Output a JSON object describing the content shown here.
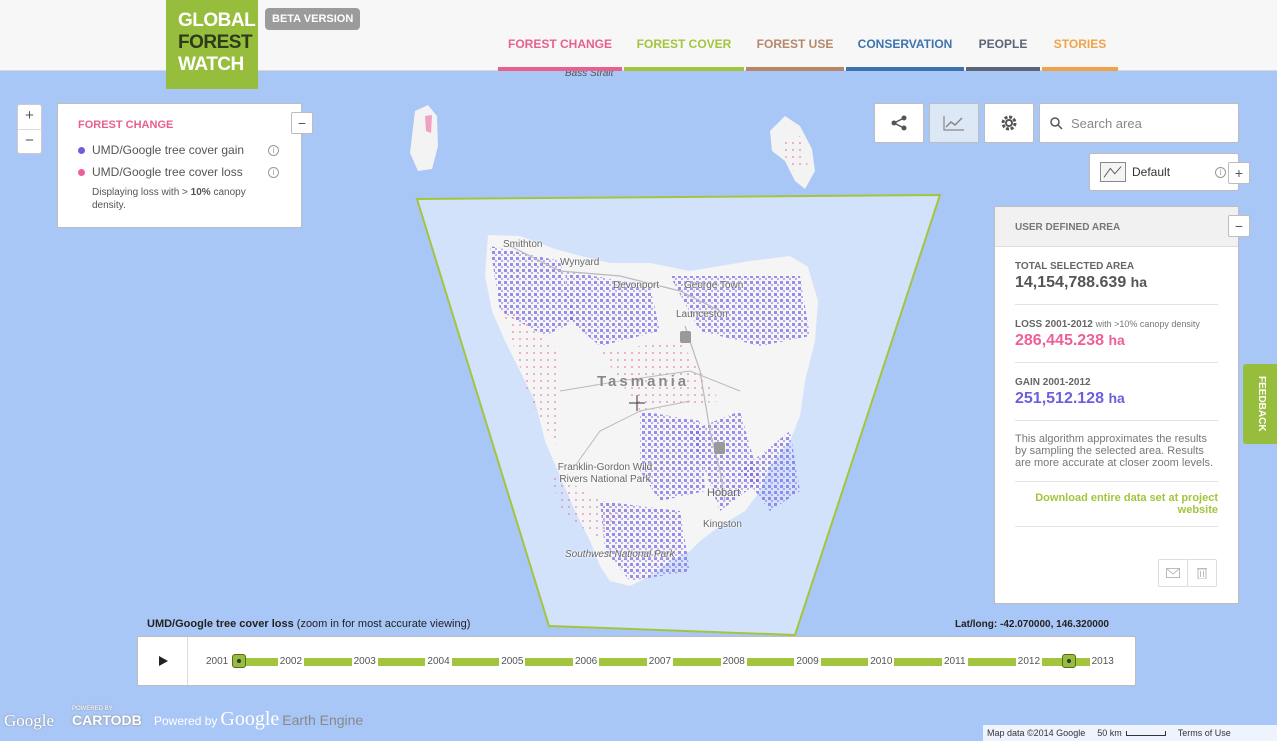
{
  "header": {
    "logo": [
      "GLOBAL",
      "FOREST",
      "WATCH"
    ],
    "beta": "BETA VERSION",
    "nav": [
      "FOREST CHANGE",
      "FOREST COVER",
      "FOREST USE",
      "CONSERVATION",
      "PEOPLE",
      "STORIES"
    ]
  },
  "colors": {
    "brand": "#97bd3d",
    "forest_change": "#e8618c",
    "forest_cover": "#a3c53d",
    "forest_use": "#b7876a",
    "conservation": "#3d73b0",
    "people": "#5b6578",
    "stories": "#f0a34a",
    "gain": "#6b5fe0",
    "loss": "#ee5f9a"
  },
  "zoom": {
    "in": "+",
    "out": "−"
  },
  "legend": {
    "title": "FOREST CHANGE",
    "items": [
      "UMD/Google tree cover gain",
      "UMD/Google tree cover loss"
    ],
    "note_prefix": "Displaying loss with > ",
    "note_threshold": "10%",
    "note_suffix": " canopy density.",
    "collapse": "−"
  },
  "toolbar": {
    "search_placeholder": "Search area",
    "icons": [
      "share-icon",
      "analysis-icon",
      "settings-icon",
      "search-icon"
    ]
  },
  "basemap": {
    "label": "Default",
    "plus": "+"
  },
  "analysis": {
    "title": "USER DEFINED AREA",
    "collapse": "−",
    "total_label": "TOTAL SELECTED AREA",
    "total_value": "14,154,788.639",
    "loss_label": "LOSS 2001-2012",
    "loss_sub": "with >10% canopy density",
    "loss_value": "286,445.238",
    "gain_label": "GAIN 2001-2012",
    "gain_value": "251,512.128",
    "unit": "ha",
    "note": "This algorithm approximates the results by sampling the selected area. Results are more accurate at closer zoom levels.",
    "download": "Download entire data set at project website"
  },
  "feedback": "FEEDBACK",
  "map": {
    "strait": "Bass Strait",
    "region": "Tasmania",
    "places": [
      "Smithton",
      "Wynyard",
      "Devonport",
      "George Town",
      "Launceston",
      "Franklin-Gordon Wild Rivers National Park",
      "Hobart",
      "Kingston",
      "Southwest National Park"
    ]
  },
  "timeline": {
    "title_bold": "UMD/Google tree cover loss",
    "title_rest": " (zoom in for most accurate viewing)",
    "latlong": "Lat/long: -42.070000, 146.320000",
    "years": [
      "2001",
      "2002",
      "2003",
      "2004",
      "2005",
      "2006",
      "2007",
      "2008",
      "2009",
      "2010",
      "2011",
      "2012",
      "2013"
    ],
    "range_start": "2001",
    "range_end": "2013"
  },
  "footer": {
    "google": "Google",
    "cartodb_small": "POWERED BY",
    "cartodb": "CARTODB",
    "powered": "Powered by",
    "powered_google": "Google",
    "earth_engine": "Earth Engine",
    "mapdata": "Map data ©2014 Google",
    "scale": "50 km",
    "terms": "Terms of Use"
  }
}
